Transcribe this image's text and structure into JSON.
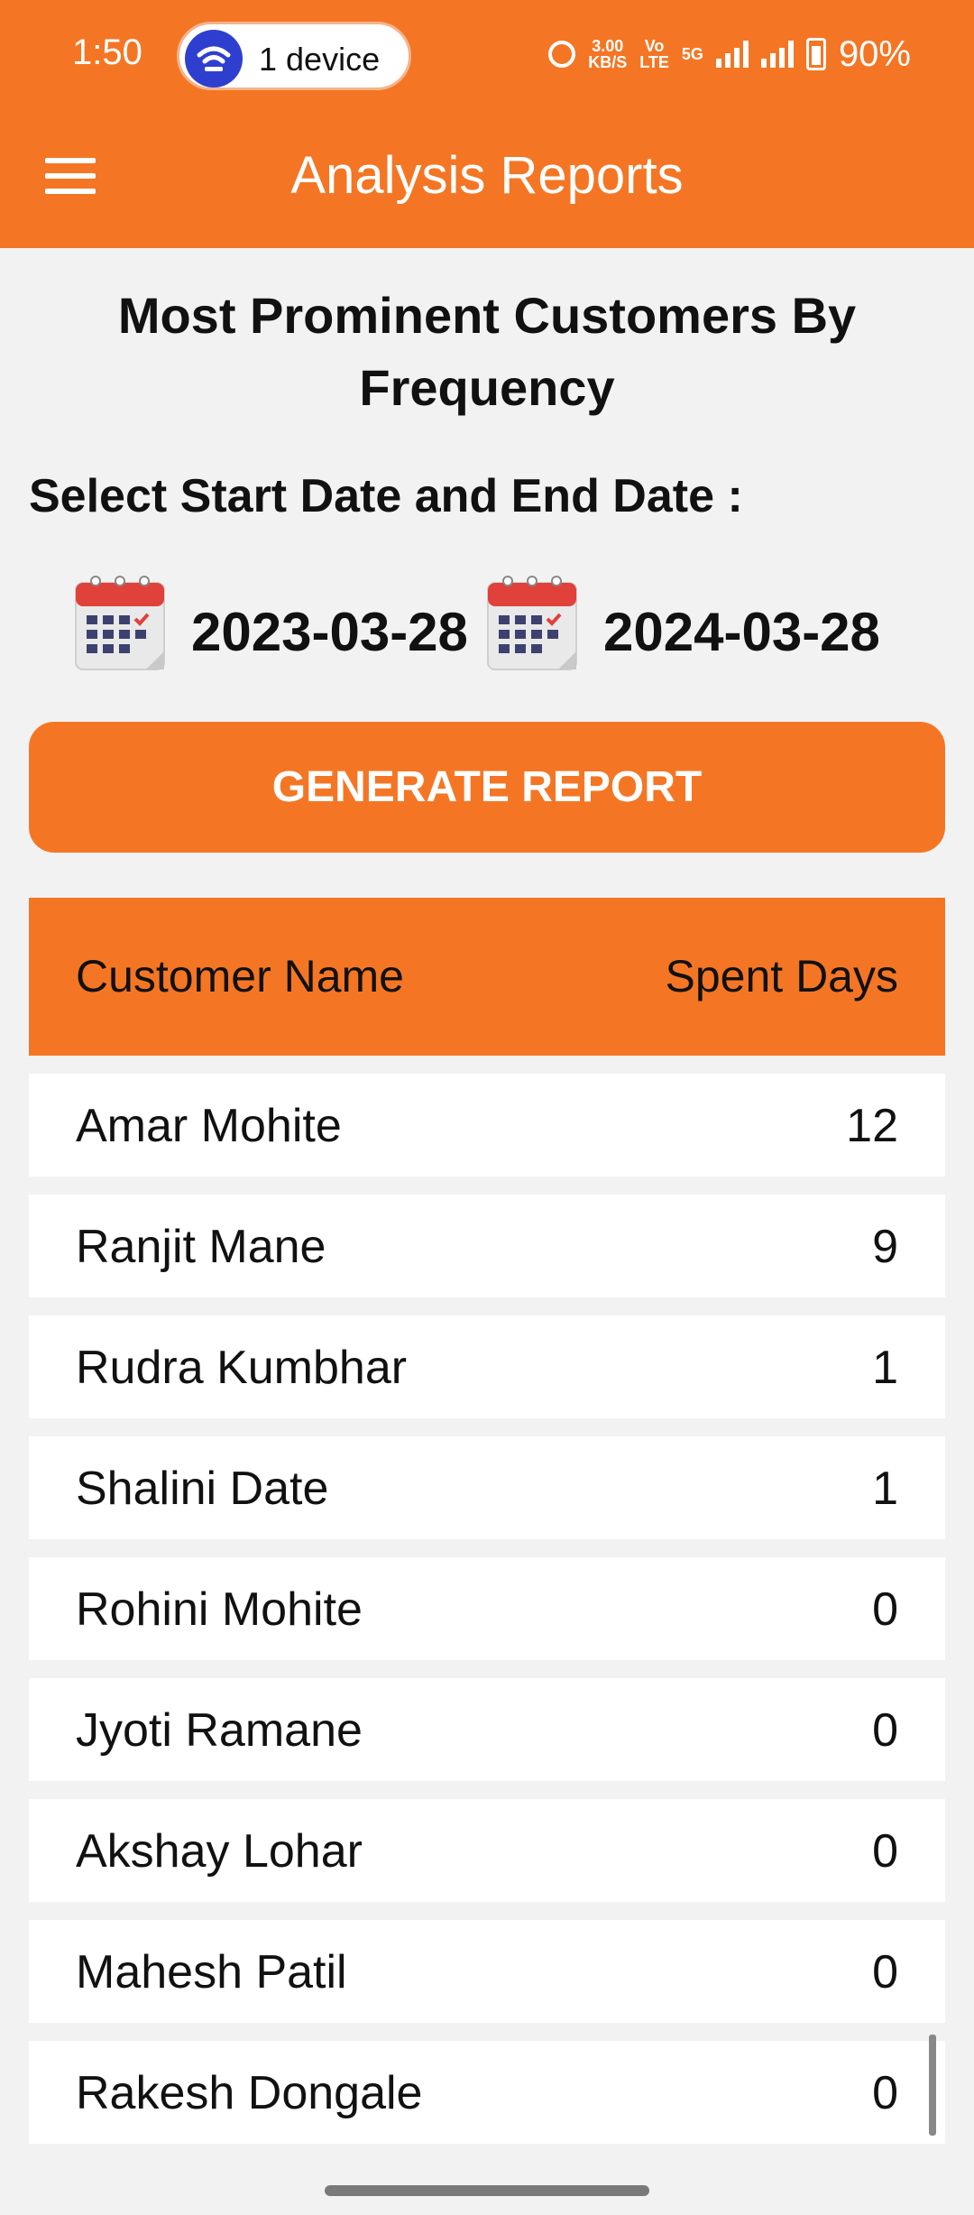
{
  "status": {
    "time": "1:50",
    "device_pill": "1 device",
    "net_speed_top": "3.00",
    "net_speed_bottom": "KB/S",
    "volte_top": "Vo",
    "volte_bottom": "LTE",
    "net_type": "5G",
    "battery": "90%"
  },
  "appbar": {
    "title": "Analysis Reports",
    "menu_icon": "hamburger-menu-icon"
  },
  "page": {
    "heading": "Most Prominent Customers By Frequency",
    "date_prompt": "Select Start Date and End Date :",
    "start_date": "2023-03-28",
    "end_date": "2024-03-28",
    "generate_label": "GENERATE REPORT"
  },
  "table": {
    "headers": [
      "Customer Name",
      "Spent Days"
    ],
    "rows": [
      {
        "name": "Amar Mohite",
        "days": "12"
      },
      {
        "name": "Ranjit Mane",
        "days": "9"
      },
      {
        "name": "Rudra Kumbhar",
        "days": "1"
      },
      {
        "name": "Shalini Date",
        "days": "1"
      },
      {
        "name": "Rohini Mohite",
        "days": "0"
      },
      {
        "name": "Jyoti Ramane",
        "days": "0"
      },
      {
        "name": "Akshay Lohar",
        "days": "0"
      },
      {
        "name": "Mahesh Patil",
        "days": "0"
      },
      {
        "name": "Rakesh Dongale",
        "days": "0"
      }
    ]
  },
  "colors": {
    "accent": "#f47624",
    "background": "#f2f2f2"
  }
}
